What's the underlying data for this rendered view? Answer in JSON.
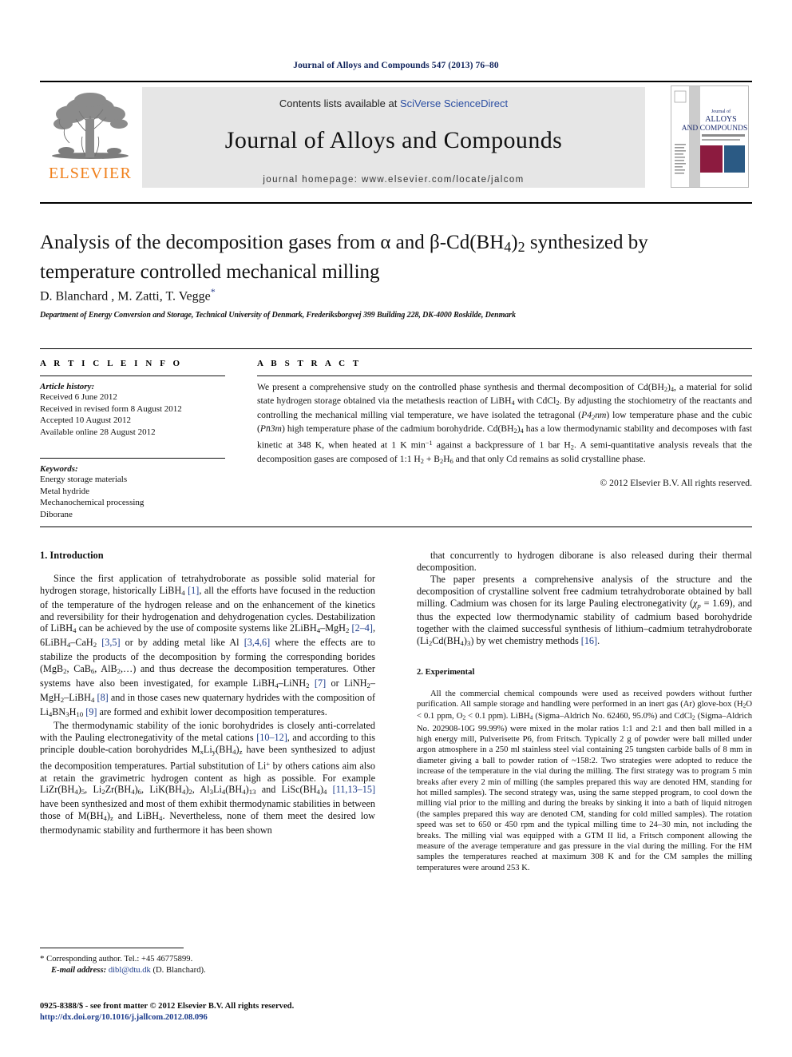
{
  "running_head": "Journal of Alloys and Compounds 547 (2013) 76–80",
  "masthead": {
    "publisher_word": "ELSEVIER",
    "contents_prefix": "Contents lists available at ",
    "sciencedirect": "SciVerse ScienceDirect",
    "journal_name": "Journal of Alloys and Compounds",
    "homepage": "journal homepage: www.elsevier.com/locate/jalcom",
    "cover": {
      "line1": "Journal of",
      "line2": "ALLOYS",
      "line3": "AND COMPOUNDS"
    }
  },
  "article": {
    "title_line1": "Analysis of the decomposition gases from α and β-Cd(BH",
    "title_sub1": "4",
    "title_mid": ")",
    "title_sub2": "2",
    "title_line1_end": " synthesized by",
    "title_line2": "temperature controlled mechanical milling",
    "authors": "D. Blanchard , M. Zatti, T. Vegge",
    "affiliation": "Department of Energy Conversion and Storage, Technical University of Denmark, Frederiksborgvej 399 Building 228, DK-4000 Roskilde, Denmark"
  },
  "article_info": {
    "heading": "A R T I C L E   I N F O",
    "history_label": "Article history:",
    "history": [
      "Received 6 June 2012",
      "Received in revised form 8 August 2012",
      "Accepted 10 August 2012",
      "Available online 28 August 2012"
    ],
    "keywords_label": "Keywords:",
    "keywords": [
      "Energy storage materials",
      "Metal hydride",
      "Mechanochemical processing",
      "Diborane"
    ]
  },
  "abstract": {
    "heading": "A B S T R A C T",
    "copyright": "© 2012 Elsevier B.V. All rights reserved."
  },
  "sections": {
    "introduction_title": "1. Introduction",
    "experimental_title": "2. Experimental"
  },
  "footnote": {
    "corresponding": "Corresponding author. Tel.: +45 46775899.",
    "email_label": "E-mail address:",
    "email": "dibl@dtu.dk",
    "email_owner": "(D. Blanchard)."
  },
  "footer": {
    "issn_line": "0925-8388/$ - see front matter © 2012 Elsevier B.V. All rights reserved.",
    "doi": "http://dx.doi.org/10.1016/j.jallcom.2012.08.096"
  },
  "colors": {
    "running_head": "#11245c",
    "link": "#1c3b8b",
    "elsevier_orange": "#f07f1a",
    "masthead_band": "#e6e6e6",
    "sciencedirect": "#2b4ea2"
  }
}
